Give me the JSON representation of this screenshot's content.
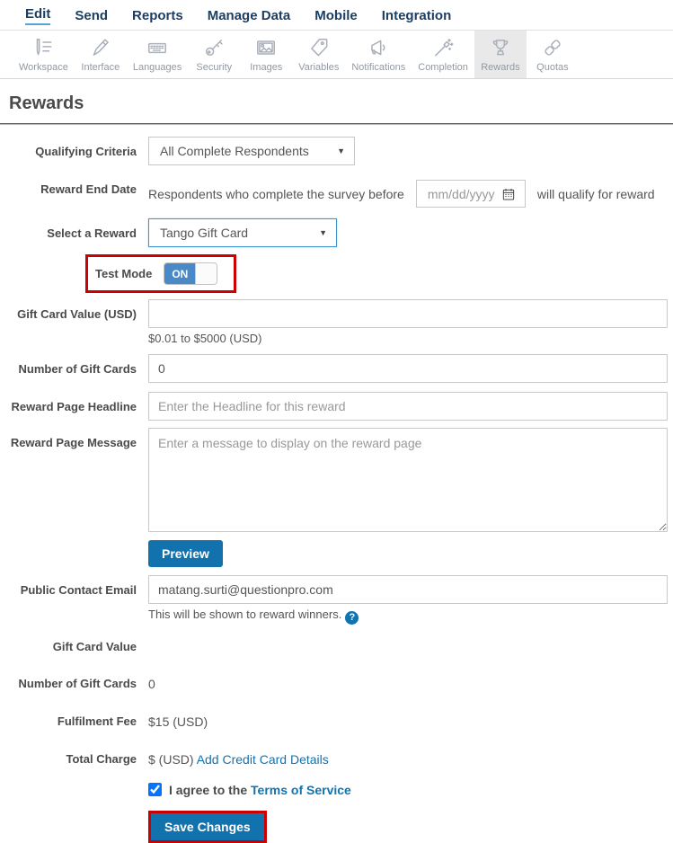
{
  "nav": {
    "items": [
      {
        "label": "Edit"
      },
      {
        "label": "Send"
      },
      {
        "label": "Reports"
      },
      {
        "label": "Manage Data"
      },
      {
        "label": "Mobile"
      },
      {
        "label": "Integration"
      }
    ]
  },
  "toolbar": {
    "items": [
      {
        "label": "Workspace"
      },
      {
        "label": "Interface"
      },
      {
        "label": "Languages"
      },
      {
        "label": "Security"
      },
      {
        "label": "Images"
      },
      {
        "label": "Variables"
      },
      {
        "label": "Notifications"
      },
      {
        "label": "Completion"
      },
      {
        "label": "Rewards"
      },
      {
        "label": "Quotas"
      }
    ]
  },
  "page": {
    "title": "Rewards"
  },
  "form": {
    "qualifying_criteria": {
      "label": "Qualifying Criteria",
      "value": "All Complete Respondents"
    },
    "reward_end_date": {
      "label": "Reward End Date",
      "prefix": "Respondents who complete the survey before",
      "placeholder": "mm/dd/yyyy",
      "suffix": "will qualify for reward"
    },
    "select_reward": {
      "label": "Select a Reward",
      "value": "Tango Gift Card"
    },
    "test_mode": {
      "label": "Test Mode",
      "state": "ON"
    },
    "gift_card_value": {
      "label": "Gift Card Value (USD)",
      "value": "",
      "hint": "$0.01 to $5000 (USD)"
    },
    "num_gift_cards": {
      "label": "Number of Gift Cards",
      "value": "0"
    },
    "headline": {
      "label": "Reward Page Headline",
      "placeholder": "Enter the Headline for this reward"
    },
    "message": {
      "label": "Reward Page Message",
      "placeholder": "Enter a message to display on the reward page"
    },
    "preview_button": "Preview",
    "contact_email": {
      "label": "Public Contact Email",
      "value": "matang.surti@questionpro.com",
      "hint": "This will be shown to reward winners.",
      "help": "?"
    },
    "summary_gift_card_value": {
      "label": "Gift Card Value",
      "value": ""
    },
    "summary_num_gift_cards": {
      "label": "Number of Gift Cards",
      "value": "0"
    },
    "fulfilment_fee": {
      "label": "Fulfilment Fee",
      "value": "$15 (USD)"
    },
    "total_charge": {
      "label": "Total Charge",
      "value": "$ (USD)",
      "link": "Add Credit Card Details"
    },
    "agree": {
      "checked": "checked",
      "text": "I agree to the",
      "link": "Terms of Service"
    },
    "save_button": "Save Changes"
  },
  "colors": {
    "nav_navy": "#1d3e63",
    "accent_blue": "#1172ae",
    "toggle_blue": "#4a89c8",
    "link_blue": "#1173b0",
    "annotation_red": "#cc0000",
    "active_tab_bg": "#e9e9e9"
  }
}
